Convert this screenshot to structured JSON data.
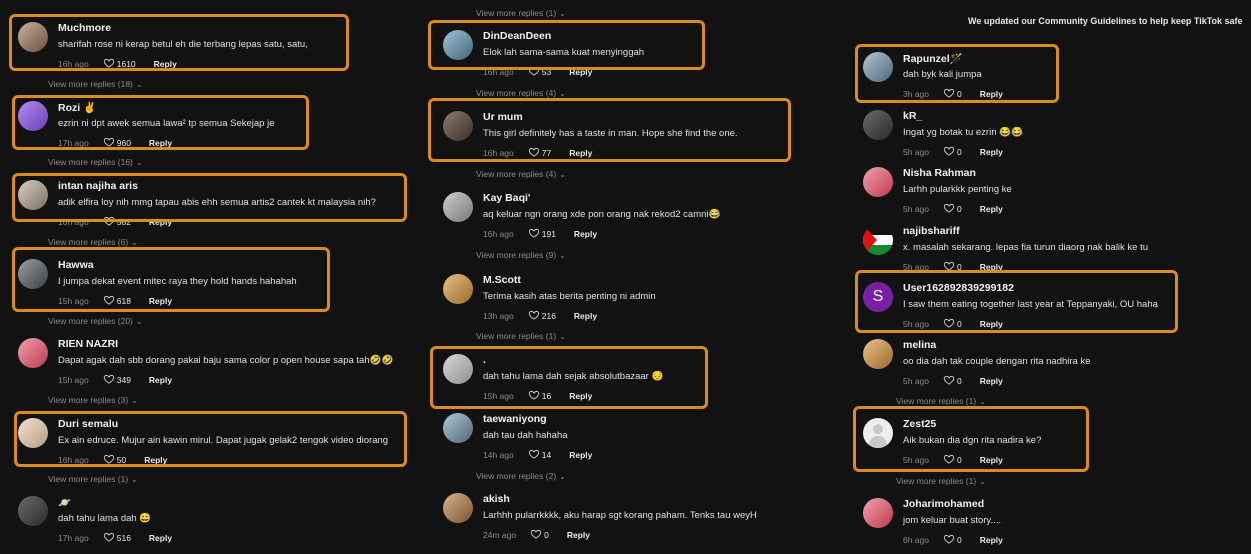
{
  "banner": "We updated our Community Guidelines to help keep TikTok safe",
  "reply_label": "Reply",
  "col1": {
    "comments": [
      {
        "name": "Muchmore",
        "text": "sharifah rose ni kerap betul eh die terbang lepas satu, satu,",
        "time": "16h ago",
        "likes": "1610"
      },
      {
        "name": "Rozi ✌️",
        "text": "ezrin ni dpt awek semua lawa² tp semua Sekejap je",
        "time": "17h ago",
        "likes": "960"
      },
      {
        "name": "intan najiha aris",
        "text": "adik elfira loy nih mmg tapau abis ehh semua artis2 cantek kt malaysia nih?",
        "time": "16h ago",
        "likes": "582"
      },
      {
        "name": "Hawwa",
        "text": "I jumpa dekat event mitec raya they hold hands hahahah",
        "time": "15h ago",
        "likes": "618"
      },
      {
        "name": "RIEN NAZRI",
        "text": "Dapat agak dah sbb dorang pakai baju sama color p open house sapa tah🤣🤣",
        "time": "15h ago",
        "likes": "349"
      },
      {
        "name": "Duri semalu",
        "text": "Ex ain edruce. Mujur ain kawin mirul. Dapat jugak gelak2 tengok video diorang",
        "time": "16h ago",
        "likes": "50"
      },
      {
        "name": "🪐",
        "text": "dah tahu lama dah 😄",
        "time": "17h ago",
        "likes": "516"
      }
    ],
    "more": [
      "View more replies (18)",
      "View more replies (16)",
      "View more replies (6)",
      "View more replies (20)",
      "View more replies (3)",
      "View more replies (1)"
    ]
  },
  "col2": {
    "top_more": "View more replies (1)",
    "comments": [
      {
        "name": "DinDeanDeen",
        "text": "Elok lah sama-sama kuat menyinggah",
        "time": "16h ago",
        "likes": "53"
      },
      {
        "name": "Ur mum",
        "text": "This girl definitely has a taste in man. Hope she find the one.",
        "time": "16h ago",
        "likes": "77"
      },
      {
        "name": "Kay Baqi'",
        "text": "aq keluar ngn orang xde pon orang nak rekod2 camni😂",
        "time": "16h ago",
        "likes": "191"
      },
      {
        "name": "M.Scott",
        "text": "Terima kasih atas berita penting ni admin",
        "time": "13h ago",
        "likes": "216"
      },
      {
        "name": ".",
        "text": "dah tahu lama dah sejak absolutbazaar 😔",
        "time": "15h ago",
        "likes": "16"
      },
      {
        "name": "taewaniyong",
        "text": "dah tau dah hahaha",
        "time": "14h ago",
        "likes": "14"
      },
      {
        "name": "akish",
        "text": "Larhhh pularrkkkk, aku harap sgt korang paham. Tenks tau weyH",
        "time": "24m ago",
        "likes": "0"
      }
    ],
    "more": [
      "View more replies (4)",
      "View more replies (4)",
      "View more replies (9)",
      "View more replies (1)",
      "View more replies (2)"
    ]
  },
  "col3": {
    "comments": [
      {
        "name": "Rapunzel🪄",
        "text": "dah byk kali jumpa",
        "time": "3h ago",
        "likes": "0"
      },
      {
        "name": "kR_",
        "text": "Ingat yg botak tu ezrin 😂😂",
        "time": "5h ago",
        "likes": "0"
      },
      {
        "name": "Nisha Rahman",
        "text": "Larhh pularkkk penting ke",
        "time": "5h ago",
        "likes": "0"
      },
      {
        "name": "najibshariff",
        "text": "x. masalah sekarang. lepas fia turun diaorg nak balik ke tu",
        "time": "5h ago",
        "likes": "0"
      },
      {
        "name": "User162892839299182",
        "text": "I saw them eating together last year at Teppanyaki, OU haha",
        "time": "5h ago",
        "likes": "0",
        "initial": "S"
      },
      {
        "name": "melina",
        "text": "oo dia dah tak couple dengan rita nadhira ke",
        "time": "5h ago",
        "likes": "0"
      },
      {
        "name": "Zest25",
        "text": "Aik bukan dia dgn rita nadira ke?",
        "time": "5h ago",
        "likes": "0"
      },
      {
        "name": "Joharimohamed",
        "text": "jom keluar buat story....",
        "time": "6h ago",
        "likes": "0"
      }
    ],
    "more": [
      "View more replies (1)",
      "View more replies (1)"
    ]
  },
  "colors": {
    "background": "#121212",
    "highlight": "#d98b1d",
    "text": "#e8e8e8",
    "muted": "#8a8a8a"
  },
  "icons": {
    "like": "heart-outline-icon",
    "expand": "chevron-down-icon"
  }
}
